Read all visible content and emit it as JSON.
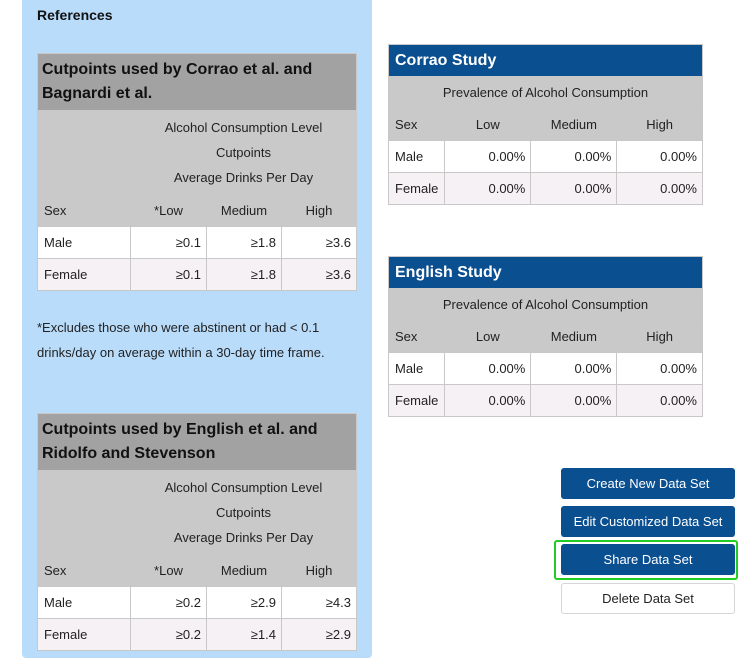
{
  "references": {
    "title": "References",
    "footnote": "*Excludes those who were abstinent or had < 0.1 drinks/day on average within a 30-day time frame.",
    "tables": [
      {
        "header": "Cutpoints used by Corrao et al. and Bagnardi et al.",
        "sub1": "Alcohol Consumption Level",
        "sub2": "Cutpoints",
        "sub3": "Average Drinks Per Day",
        "columns": [
          "Sex",
          "*Low",
          "Medium",
          "High"
        ],
        "rows": [
          {
            "sex": "Male",
            "low": "≥0.1",
            "medium": "≥1.8",
            "high": "≥3.6"
          },
          {
            "sex": "Female",
            "low": "≥0.1",
            "medium": "≥1.8",
            "high": "≥3.6"
          }
        ]
      },
      {
        "header": "Cutpoints used by English et al. and Ridolfo and Stevenson",
        "sub1": "Alcohol Consumption Level",
        "sub2": "Cutpoints",
        "sub3": "Average Drinks Per Day",
        "columns": [
          "Sex",
          "*Low",
          "Medium",
          "High"
        ],
        "rows": [
          {
            "sex": "Male",
            "low": "≥0.2",
            "medium": "≥2.9",
            "high": "≥4.3"
          },
          {
            "sex": "Female",
            "low": "≥0.2",
            "medium": "≥1.4",
            "high": "≥2.9"
          }
        ]
      }
    ]
  },
  "studies": [
    {
      "title": "Corrao Study",
      "subtitle": "Prevalence of Alcohol Consumption",
      "columns": [
        "Sex",
        "Low",
        "Medium",
        "High"
      ],
      "rows": [
        {
          "sex": "Male",
          "low": "0.00%",
          "medium": "0.00%",
          "high": "0.00%"
        },
        {
          "sex": "Female",
          "low": "0.00%",
          "medium": "0.00%",
          "high": "0.00%"
        }
      ]
    },
    {
      "title": "English Study",
      "subtitle": "Prevalence of Alcohol Consumption",
      "columns": [
        "Sex",
        "Low",
        "Medium",
        "High"
      ],
      "rows": [
        {
          "sex": "Male",
          "low": "0.00%",
          "medium": "0.00%",
          "high": "0.00%"
        },
        {
          "sex": "Female",
          "low": "0.00%",
          "medium": "0.00%",
          "high": "0.00%"
        }
      ]
    }
  ],
  "buttons": {
    "create": "Create New Data Set",
    "edit": "Edit Customized Data Set",
    "share": "Share Data Set",
    "delete": "Delete Data Set"
  },
  "colors": {
    "panel_bg": "#b9dcfb",
    "study_header": "#0a4f90",
    "highlight": "#22cc22"
  }
}
